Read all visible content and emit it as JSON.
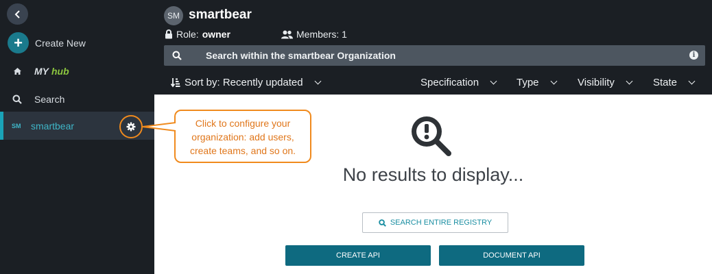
{
  "sidebar": {
    "create_new": "Create New",
    "my_hub": {
      "my": "MY",
      "hub": "hub"
    },
    "search": "Search",
    "org": {
      "abbr": "SM",
      "name": "smartbear"
    }
  },
  "callout": {
    "text": "Click to configure your organization: add users, create teams, and so on."
  },
  "header": {
    "avatar": "SM",
    "title": "smartbear",
    "role_label": "Role:",
    "role_value": "owner",
    "members": "Members: 1",
    "search_placeholder": "Search within the smartbear Organization",
    "info": "i"
  },
  "filters": {
    "sort": "Sort by: Recently updated",
    "specification": "Specification",
    "type": "Type",
    "visibility": "Visibility",
    "state": "State"
  },
  "content": {
    "message": "No results to display...",
    "search_registry": "SEARCH ENTIRE REGISTRY",
    "create_api": "CREATE API",
    "document_api": "DOCUMENT API"
  },
  "colors": {
    "accent": "#1a7a8c",
    "callout": "#f08a1d",
    "sidebar": "#1b1f24",
    "selected": "#2c343e"
  }
}
